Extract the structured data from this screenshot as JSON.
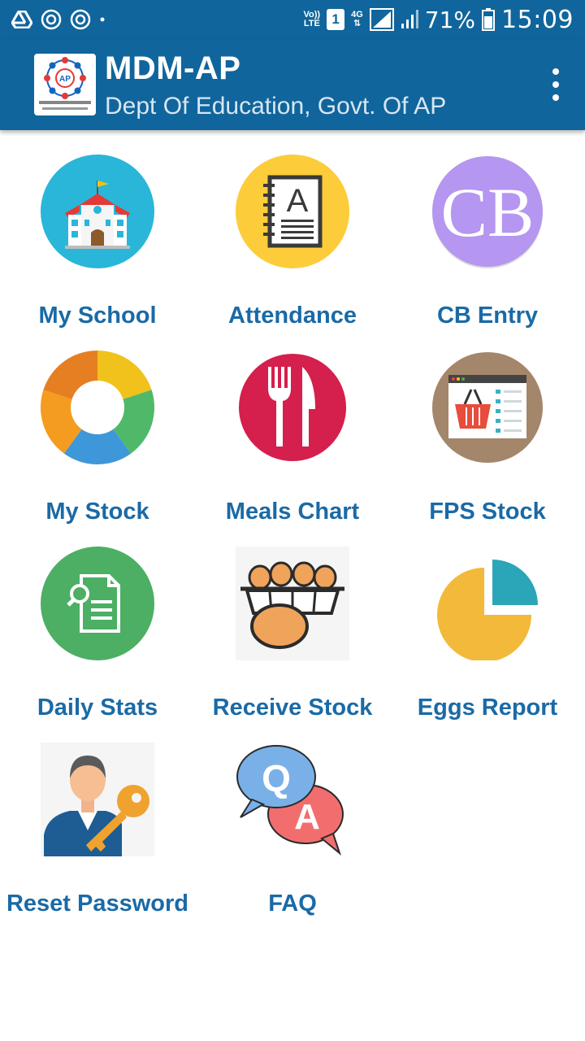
{
  "status_bar": {
    "volte": "Vo))",
    "lte": "LTE",
    "sim": "1",
    "network": "4G",
    "battery": "71%",
    "time": "15:09"
  },
  "app_bar": {
    "title": "MDM-AP",
    "subtitle": "Dept Of Education, Govt. Of AP",
    "logo_text": "AP"
  },
  "tiles": [
    {
      "label": "My School",
      "icon": "school-icon"
    },
    {
      "label": "Attendance",
      "icon": "attendance-book-icon"
    },
    {
      "label": "CB Entry",
      "icon": "cb-icon",
      "icon_text": "CB"
    },
    {
      "label": "My Stock",
      "icon": "donut-chart-icon"
    },
    {
      "label": "Meals Chart",
      "icon": "fork-knife-icon"
    },
    {
      "label": "FPS Stock",
      "icon": "shopping-basket-icon"
    },
    {
      "label": "Daily Stats",
      "icon": "document-search-icon"
    },
    {
      "label": "Receive Stock",
      "icon": "eggs-tray-icon"
    },
    {
      "label": "Eggs Report",
      "icon": "pie-chart-icon"
    },
    {
      "label": "Reset Password",
      "icon": "user-key-icon"
    },
    {
      "label": "FAQ",
      "icon": "qa-bubbles-icon",
      "q": "Q",
      "a": "A"
    }
  ],
  "colors": {
    "primary": "#10659c",
    "label": "#1a6aa6"
  }
}
